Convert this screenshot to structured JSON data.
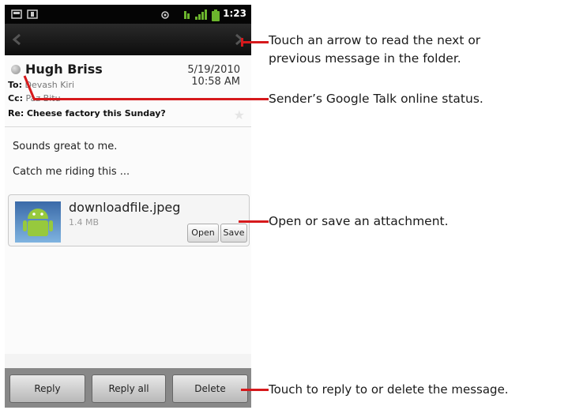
{
  "status_bar": {
    "time": "1:23"
  },
  "message": {
    "sender": "Hugh Briss",
    "date": "5/19/2010",
    "time": "10:58 AM",
    "to_label": "To:",
    "to_value": "Devash Kiri",
    "cc_label": "Cc:",
    "cc_value": "Paz Bitu",
    "subject_label": "Re:",
    "subject": "Cheese factory this Sunday?",
    "body_lines": [
      "Sounds great to me.",
      "Catch me riding this ..."
    ]
  },
  "attachment": {
    "filename": "downloadfile.jpeg",
    "size": "1.4 MB",
    "open_label": "Open",
    "save_label": "Save"
  },
  "actions": {
    "reply": "Reply",
    "reply_all": "Reply all",
    "delete": "Delete"
  },
  "callouts": {
    "arrows_line1": "Touch an arrow to read the next or",
    "arrows_line2": "previous message in the folder.",
    "status": "Sender’s Google Talk online status.",
    "attachment": "Open or save an attachment.",
    "reply": "Touch to reply to or delete the message."
  },
  "colors": {
    "callout_line": "#d6191c"
  }
}
